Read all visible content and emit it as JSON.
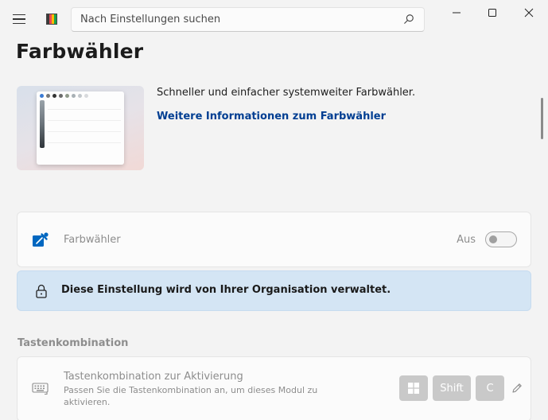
{
  "titlebar": {
    "search_placeholder": "Nach Einstellungen suchen",
    "logo_colors": [
      "#3a3a3a",
      "#e74856",
      "#ffb900",
      "#16a34a"
    ]
  },
  "page": {
    "title": "Farbwähler"
  },
  "hero": {
    "description": "Schneller und einfacher systemweiter Farbwähler.",
    "link": "Weitere Informationen zum Farbwähler"
  },
  "module": {
    "label": "Farbwähler",
    "state_label": "Aus",
    "enabled": false,
    "icon": "color-picker-icon",
    "accent": "#0067c0"
  },
  "policy": {
    "message": "Diese Einstellung wird von Ihrer Organisation verwaltet.",
    "background": "#d4e5f4"
  },
  "shortcut_section": {
    "title": "Tastenkombination",
    "card_title": "Tastenkombination zur Aktivierung",
    "card_desc": "Passen Sie die Tastenkombination an, um dieses Modul zu aktivieren.",
    "keys": {
      "win": "windows-key",
      "shift": "Shift",
      "c": "C"
    }
  }
}
